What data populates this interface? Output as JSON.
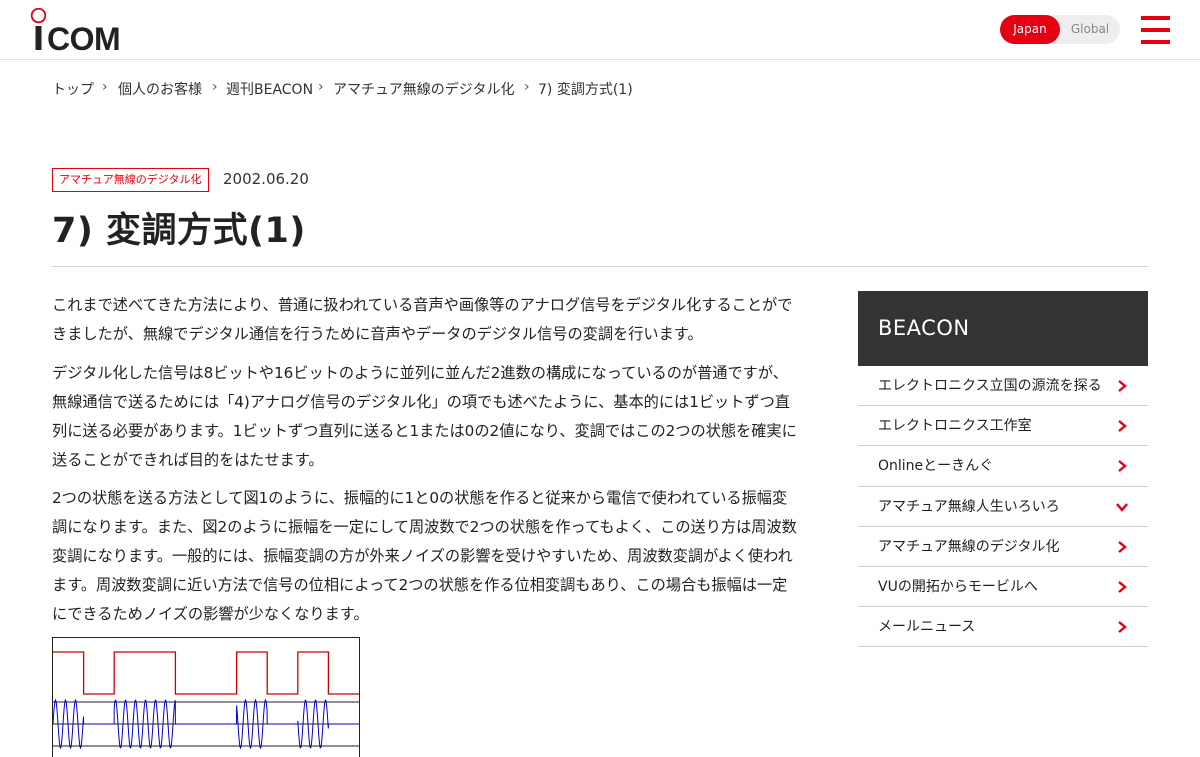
{
  "header": {
    "logo_text": "ICOM",
    "region": {
      "japan": "Japan",
      "global": "Global",
      "active": "Japan"
    },
    "accent_color": "#e60012"
  },
  "breadcrumb": [
    "トップ",
    "個人のお客様",
    "週刊BEACON",
    "アマチュア無線のデジタル化",
    "7) 変調方式(1)"
  ],
  "article": {
    "category": "アマチュア無線のデジタル化",
    "date": "2002.06.20",
    "title": "7) 変調方式(1)",
    "paragraphs": [
      "これまで述べてきた方法により、普通に扱われている音声や画像等のアナログ信号をデジタル化することができましたが、無線でデジタル通信を行うために音声やデータのデジタル信号の変調を行います。",
      "デジタル化した信号は8ビットや16ビットのように並列に並んだ2進数の構成になっているのが普通ですが、無線通信で送るためには「4)アナログ信号のデジタル化」の項でも述べたように、基本的には1ビットずつ直列に送る必要があります。1ビットずつ直列に送ると1または0の2値になり、変調ではこの2つの状態を確実に送ることができれば目的をはたせます。",
      "2つの状態を送る方法として図1のように、振幅的に1と0の状態を作ると従来から電信で使われている振幅変調になります。また、図2のように振幅を一定にして周波数で2つの状態を作ってもよく、この送り方は周波数変調になります。一般的には、振幅変調の方が外来ノイズの影響を受けやすいため、周波数変調がよく使われます。周波数変調に近い方法で信号の位相によって2つの状態を作る位相変調もあり、この場合も振幅は一定にできるためノイズの影響が少なくなります。"
    ]
  },
  "figure1": {
    "bits": [
      1,
      0,
      1,
      1,
      0,
      0,
      1,
      0,
      1,
      0
    ],
    "signal_color": "#cc0000",
    "carrier_color": "#0000cc"
  },
  "sidebar": {
    "title": "BEACON",
    "items": [
      {
        "label": "エレクトロニクス立国の源流を探る",
        "icon": "chevron-right"
      },
      {
        "label": "エレクトロニクス工作室",
        "icon": "chevron-right"
      },
      {
        "label": "Onlineとーきんぐ",
        "icon": "chevron-right"
      },
      {
        "label": "アマチュア無線人生いろいろ",
        "icon": "chevron-down"
      },
      {
        "label": "アマチュア無線のデジタル化",
        "icon": "chevron-right"
      },
      {
        "label": "VUの開拓からモービルへ",
        "icon": "chevron-right"
      },
      {
        "label": "メールニュース",
        "icon": "chevron-right"
      }
    ]
  }
}
